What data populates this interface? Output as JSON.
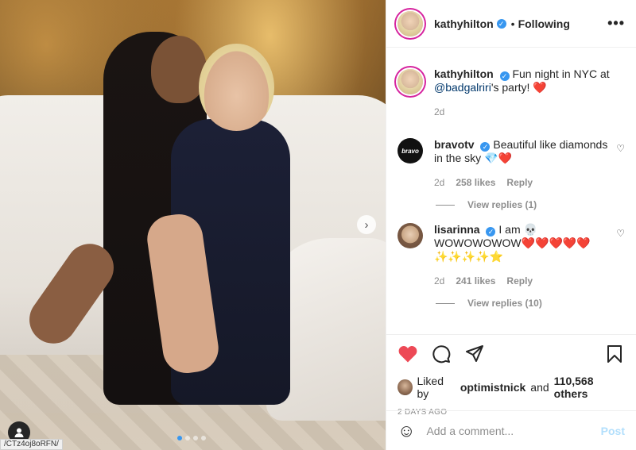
{
  "post": {
    "username": "kathyhilton",
    "following_label": "Following",
    "more_label": "•••"
  },
  "caption": {
    "username": "kathyhilton",
    "text_before": "Fun night in NYC at",
    "mention": "@badgalriri",
    "text_after": "'s party! ❤️",
    "time": "2d"
  },
  "comments": [
    {
      "username": "bravotv",
      "avatar_label": "bravo",
      "text": "Beautiful like diamonds in the sky 💎❤️",
      "time": "2d",
      "likes": "258 likes",
      "reply_label": "Reply",
      "view_replies": "View replies (1)"
    },
    {
      "username": "lisarinna",
      "text": "I am 💀 WOWOWOWOW❤️❤️❤️❤️❤️ ✨✨✨✨⭐",
      "time": "2d",
      "likes": "241 likes",
      "reply_label": "Reply",
      "view_replies": "View replies (10)"
    }
  ],
  "likes": {
    "prefix": "Liked by",
    "user": "optimistnick",
    "and": "and",
    "count": "110,568 others"
  },
  "timestamp": "2 DAYS AGO",
  "add_comment": {
    "placeholder": "Add a comment...",
    "post_label": "Post"
  },
  "browser": {
    "url_fragment": "/CTz4oj8oRFN/"
  },
  "colors": {
    "heart": "#ed4956",
    "verified": "#3897f0",
    "post_disabled": "#b2dffc"
  }
}
